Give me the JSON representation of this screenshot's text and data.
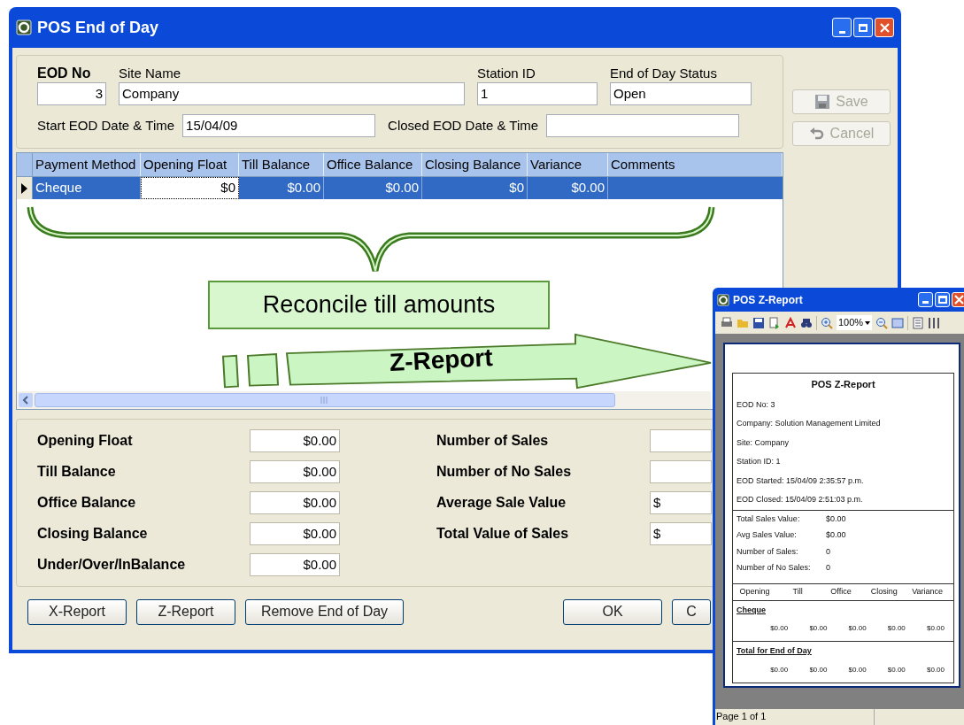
{
  "main_window": {
    "title": "POS End of Day",
    "header_fields": [
      {
        "label": "EOD No",
        "value": "3"
      },
      {
        "label": "Site Name",
        "value": "Company"
      },
      {
        "label": "Station ID",
        "value": "1"
      },
      {
        "label": "End of Day Status",
        "value": "Open"
      }
    ],
    "date_fields": [
      {
        "label": "Start EOD Date & Time",
        "value": "15/04/09"
      },
      {
        "label": "Closed EOD Date & Time"
      }
    ],
    "side_buttons": [
      {
        "label": "Save",
        "disabled": true
      },
      {
        "label": "Cancel",
        "disabled": true
      }
    ],
    "grid": {
      "columns": [
        "Payment Method",
        "Opening Float",
        "Till Balance",
        "Office Balance",
        "Closing Balance",
        "Variance",
        "Comments"
      ],
      "rows": [
        {
          "selected": true,
          "cells": [
            {
              "text": "Cheque",
              "editing": false
            },
            {
              "text": "$0",
              "editing": true
            },
            {
              "text": "$0.00",
              "editing": false
            },
            {
              "text": "$0.00",
              "editing": false
            },
            {
              "text": "$0",
              "editing": false
            },
            {
              "text": "$0.00",
              "editing": false
            }
          ]
        }
      ]
    },
    "summary_left": [
      {
        "label": "Opening Float",
        "value": "$0.00"
      },
      {
        "label": "Till Balance",
        "value": "$0.00"
      },
      {
        "label": "Office Balance",
        "value": "$0.00"
      },
      {
        "label": "Closing Balance",
        "value": "$0.00"
      },
      {
        "label": "Under/Over/InBalance",
        "value": "$0.00"
      }
    ],
    "summary_right": [
      {
        "label": "Number of Sales"
      },
      {
        "label": "Number of No Sales"
      },
      {
        "label": "Average Sale Value",
        "value": "$"
      },
      {
        "label": "Total Value of Sales",
        "value": "$"
      }
    ],
    "buttons": [
      "X-Report",
      "Z-Report",
      "Remove End of Day",
      "OK",
      "C"
    ]
  },
  "report_window": {
    "title": "POS Z-Report",
    "zoom": "100%",
    "report_title": "POS Z-Report",
    "info": [
      "EOD No: 3",
      "Company: Solution Management Limited",
      "Site: Company",
      "Station ID: 1",
      "EOD Started: 15/04/09 2:35:57 p.m.",
      "EOD Closed: 15/04/09 2:51:03 p.m."
    ],
    "stats": [
      {
        "label": "Total Sales Value:",
        "value": "$0.00"
      },
      {
        "label": "Avg Sales Value:",
        "value": "$0.00"
      },
      {
        "label": "Number of Sales:",
        "value": "0"
      },
      {
        "label": "Number of No Sales:",
        "value": "0"
      }
    ],
    "columns": [
      "Opening",
      "Till",
      "Office",
      "Closing",
      "Variance"
    ],
    "sections": [
      {
        "name": "Cheque",
        "values": [
          "$0.00",
          "$0.00",
          "$0.00",
          "$0.00",
          "$0.00"
        ]
      },
      {
        "name": "Total for End of Day",
        "values": [
          "$0.00",
          "$0.00",
          "$0.00",
          "$0.00",
          "$0.00"
        ]
      }
    ],
    "status": "Page 1 of 1"
  },
  "annotations": {
    "callout": "Reconcile till amounts",
    "arrow_label": "Z-Report"
  }
}
